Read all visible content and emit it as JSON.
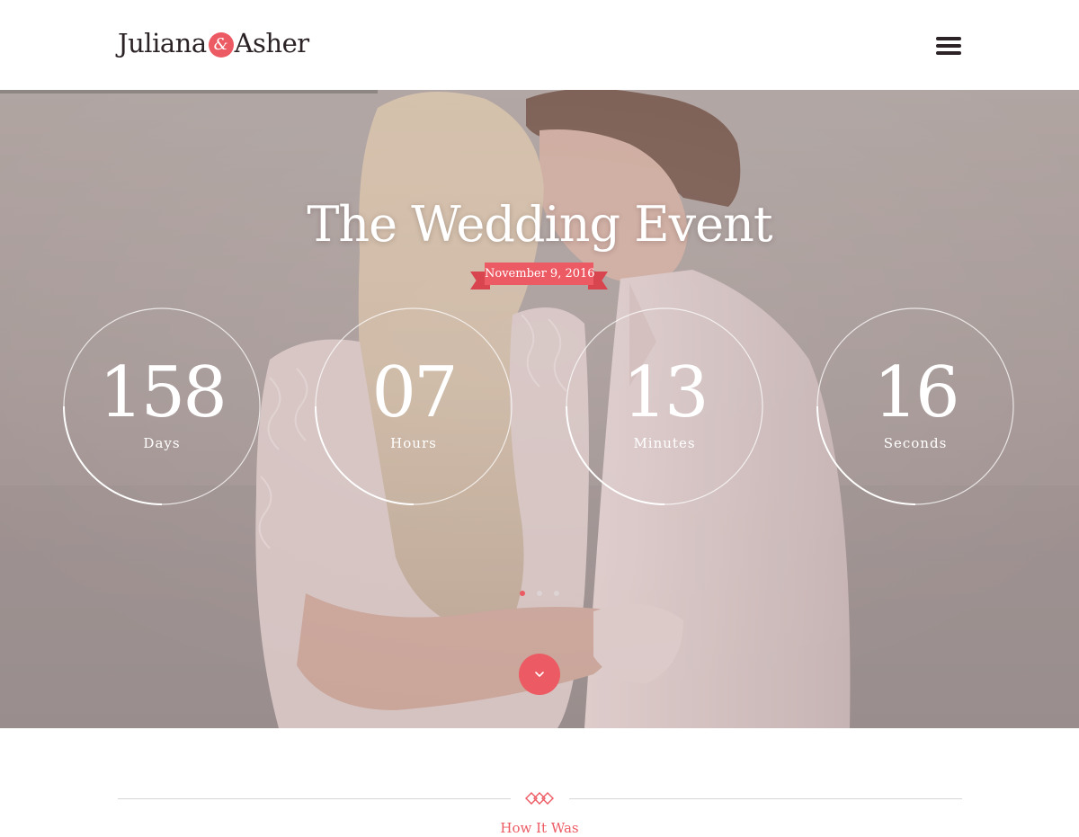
{
  "header": {
    "logo": {
      "first": "Juliana",
      "amp": "&",
      "second": "Asher"
    },
    "menu_icon": "hamburger-menu-icon"
  },
  "hero": {
    "title": "The Wedding Event",
    "date": "November 9, 2016",
    "countdown": [
      {
        "value": "158",
        "unit": "Days"
      },
      {
        "value": "07",
        "unit": "Hours"
      },
      {
        "value": "13",
        "unit": "Minutes"
      },
      {
        "value": "16",
        "unit": "Seconds"
      }
    ],
    "slider": {
      "slide_count": 3,
      "active_slide": 1
    },
    "scroll_icon": "chevron-down-icon",
    "slide_progress": 0.35
  },
  "next_section": {
    "label": "How It Was",
    "ornament_icon": "diamond-ornament-icon"
  },
  "colors": {
    "accent": "#ec5a63",
    "text_dark": "#2c2326",
    "white": "#ffffff"
  }
}
